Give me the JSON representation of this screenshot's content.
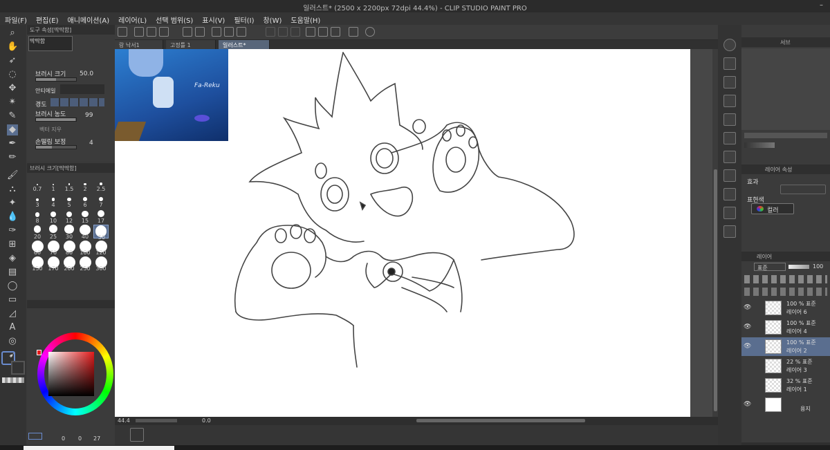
{
  "window": {
    "title": "일러스트* (2500 x 2200px 72dpi 44.4%)  - CLIP STUDIO PAINT PRO"
  },
  "menu": [
    "파일(F)",
    "편집(E)",
    "애니메이션(A)",
    "레이어(L)",
    "선택 범위(S)",
    "표시(V)",
    "필터(I)",
    "창(W)",
    "도움말(H)"
  ],
  "tool_property": {
    "header": "도구 속성[딱딱함]",
    "brush_name": "딱딱함",
    "brush_size_label": "브러시 크기",
    "brush_size_value": "50.0",
    "antialias_label": "안티에일",
    "hardness_label": "경도",
    "density_label": "브러시 농도",
    "density_value": "99",
    "vector_label": "벡터 지우",
    "stabilization_label": "손떨림 보정",
    "stabilization_value": "4"
  },
  "brush_size_panel": {
    "header": "브러시 크기[딱딱함]",
    "sizes": [
      "0.7",
      "1",
      "1.5",
      "2",
      "2.5",
      "3",
      "4",
      "5",
      "6",
      "7",
      "8",
      "10",
      "12",
      "15",
      "17",
      "20",
      "25",
      "30",
      "40",
      "50",
      "60",
      "70",
      "80",
      "100",
      "120",
      "150",
      "170",
      "200",
      "250",
      "300"
    ],
    "selected": "50"
  },
  "color_panel": {
    "counter_a": "0",
    "counter_b": "0",
    "counter_c": "27",
    "ring_hue": "#e31b1b"
  },
  "tabs": [
    {
      "label": "랑 낙서1"
    },
    {
      "label": "고정틀 1"
    },
    {
      "label": "일러스트*"
    }
  ],
  "active_tab": "일러스트*",
  "status": {
    "zoom": "44.4",
    "angle": "0.0"
  },
  "navigator": {
    "label": "Fa-Reku"
  },
  "right_panel": {
    "nav_title": "서브",
    "layer_prop_header": "레이어 속성",
    "effect_label": "효과",
    "color_label": "표현색",
    "color_value": "컬러",
    "layer_header": "레이어",
    "blend_mode": "표준",
    "opacity": "100",
    "layers": [
      {
        "top": "100 % 표준",
        "name": "레이어 6",
        "visible": true,
        "selected": false
      },
      {
        "top": "100 % 표준",
        "name": "레이어 4",
        "visible": true,
        "selected": false
      },
      {
        "top": "100 % 표준",
        "name": "레이어 2",
        "visible": true,
        "selected": true
      },
      {
        "top": "22 % 표준",
        "name": "레이어 3",
        "visible": false,
        "selected": false
      },
      {
        "top": "32 % 표준",
        "name": "레이어 1",
        "visible": false,
        "selected": false
      },
      {
        "top": "",
        "name": "용지",
        "visible": true,
        "selected": false
      }
    ]
  }
}
